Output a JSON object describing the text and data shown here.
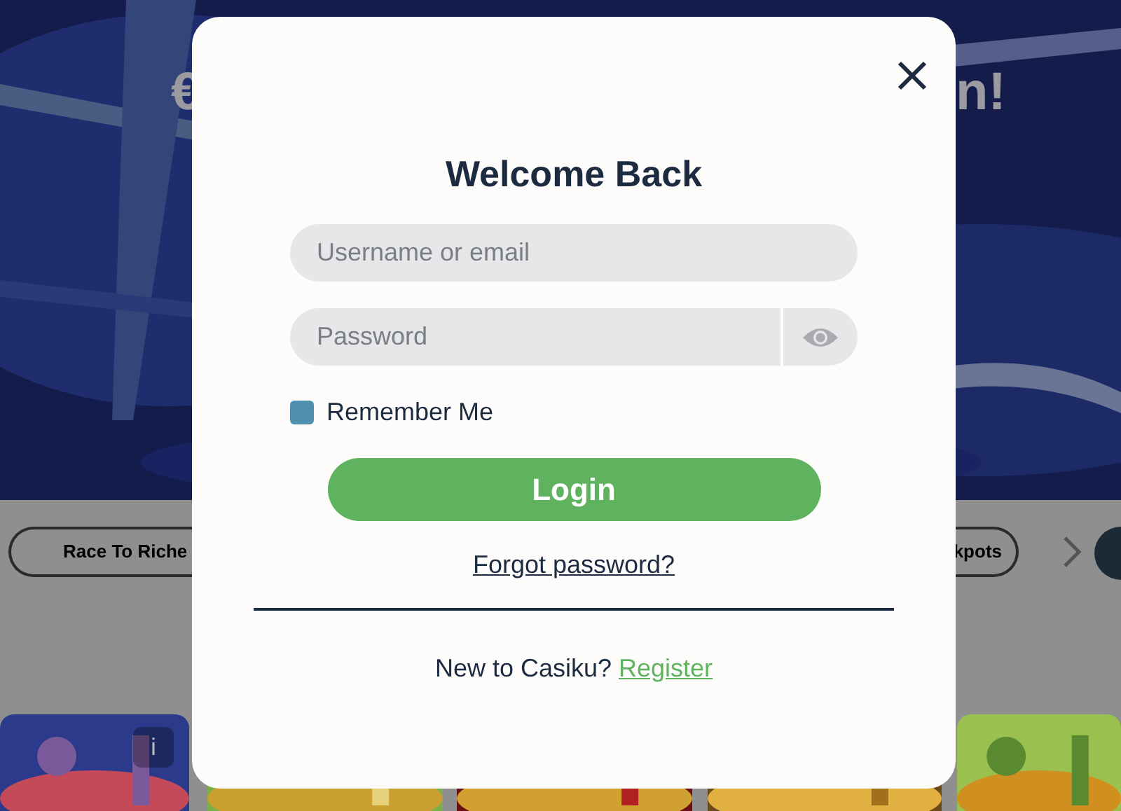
{
  "hero": {
    "kind": "picture",
    "text_left": "€",
    "text_right": "n!"
  },
  "categories": [
    {
      "label": "Race To Riche"
    },
    {
      "label": "kpots"
    }
  ],
  "games": [
    {
      "kind": "picture",
      "info": "i"
    },
    {
      "kind": "picture"
    },
    {
      "kind": "picture"
    },
    {
      "kind": "picture"
    },
    {
      "kind": "picture"
    }
  ],
  "modal": {
    "title": "Welcome Back",
    "username": {
      "placeholder": "Username or email"
    },
    "password": {
      "placeholder": "Password"
    },
    "remember": {
      "label": "Remember Me",
      "checked": false
    },
    "login": "Login",
    "forgot": "Forgot password?",
    "register_prompt": "New to Casiku?",
    "register_link": "Register"
  }
}
